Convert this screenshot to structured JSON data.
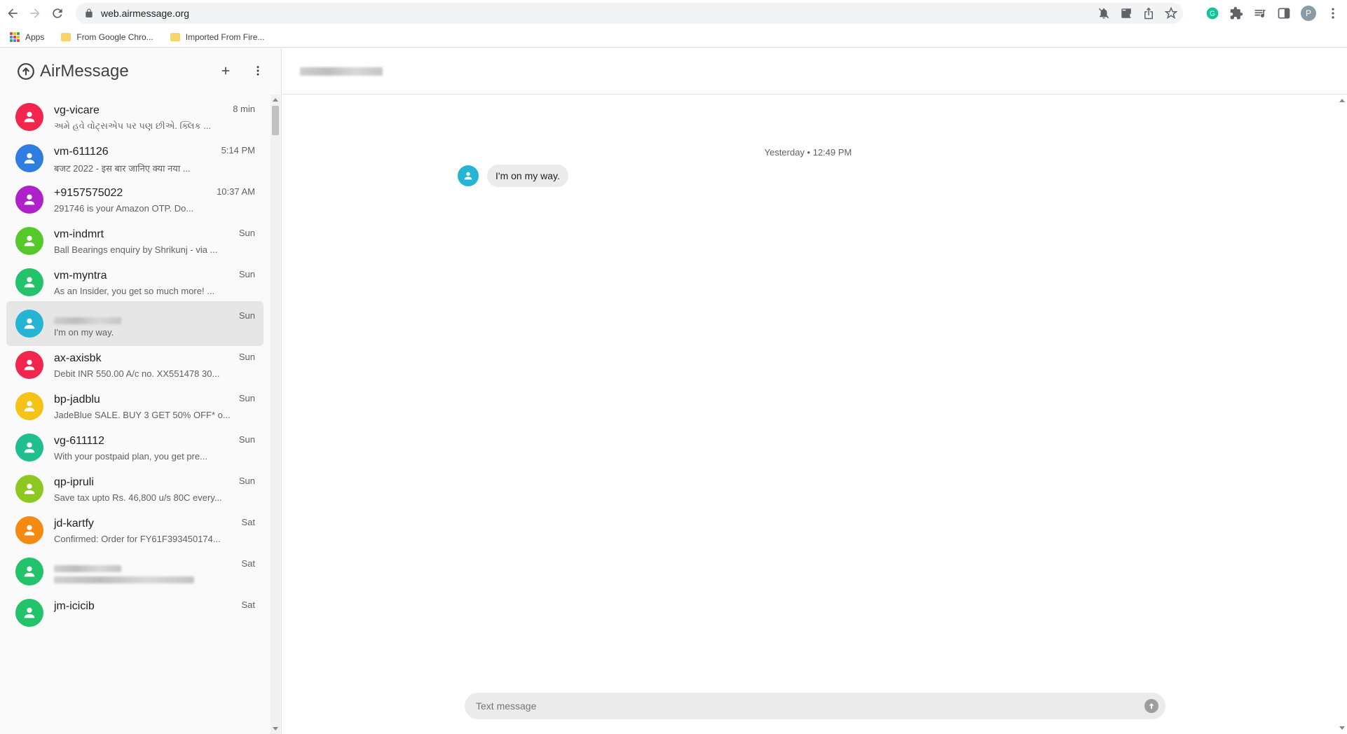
{
  "browser": {
    "url": "web.airmessage.org",
    "bookmarks": [
      {
        "label": "Apps"
      },
      {
        "label": "From Google Chro..."
      },
      {
        "label": "Imported From Fire..."
      }
    ],
    "profile_initial": "P"
  },
  "app": {
    "title": "AirMessage"
  },
  "conversations": [
    {
      "name": "vg-vicare",
      "preview": "અમે હવે વોટ્સએપ પર પણ છીએ. ક્લિક ...",
      "time": "8 min",
      "color": "#f0264e"
    },
    {
      "name": "vm-611126",
      "preview": "बजट 2022 - इस बार जानिए क्या नया ...",
      "time": "5:14 PM",
      "color": "#2f7de1"
    },
    {
      "name": "+9157575022",
      "preview": "291746 is your Amazon OTP. Do...",
      "time": "10:37 AM",
      "color": "#b022c9"
    },
    {
      "name": "vm-indmrt",
      "preview": "Ball Bearings enquiry by Shrikunj - via ...",
      "time": "Sun",
      "color": "#55c82a"
    },
    {
      "name": "vm-myntra",
      "preview": "As an Insider, you get so much more! ...",
      "time": "Sun",
      "color": "#22c36a"
    },
    {
      "name": "",
      "preview": "I'm on my way.",
      "time": "Sun",
      "color": "#26b4d4",
      "blurred_name": true,
      "active": true
    },
    {
      "name": "ax-axisbk",
      "preview": "Debit INR 550.00 A/c no. XX551478 30...",
      "time": "Sun",
      "color": "#f0264e"
    },
    {
      "name": "bp-jadblu",
      "preview": "JadeBlue SALE. BUY 3 GET 50% OFF* o...",
      "time": "Sun",
      "color": "#f5c218"
    },
    {
      "name": "vg-611112",
      "preview": "With your postpaid plan, you get pre...",
      "time": "Sun",
      "color": "#1fbf8f"
    },
    {
      "name": "qp-ipruli",
      "preview": "Save tax upto Rs. 46,800 u/s 80C every...",
      "time": "Sun",
      "color": "#8cc820"
    },
    {
      "name": "jd-kartfy",
      "preview": "Confirmed: Order for FY61F393450174...",
      "time": "Sat",
      "color": "#f58a12"
    },
    {
      "name": "",
      "preview": "",
      "time": "Sat",
      "color": "#22c36a",
      "blurred_name": true,
      "blurred_preview": true
    },
    {
      "name": "jm-icicib",
      "preview": "",
      "time": "Sat",
      "color": "#22c36a"
    }
  ],
  "chat": {
    "timestamp": "Yesterday • 12:49 PM",
    "messages": [
      {
        "text": "I'm on my way."
      }
    ],
    "composer_placeholder": "Text message"
  }
}
